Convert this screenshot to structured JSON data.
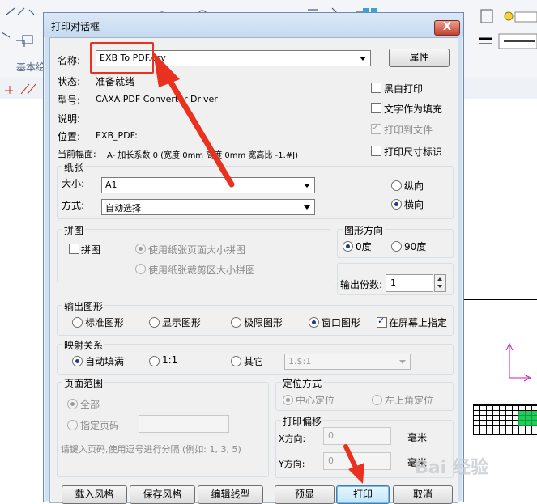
{
  "background_app": {
    "group_label": "基本绘"
  },
  "dialog": {
    "title": "打印对话框",
    "close_label": "X",
    "name_label": "名称:",
    "name_value": "EXB To PDF.drv",
    "properties_button": "属性",
    "status_label": "状态:",
    "status_value": "准备就绪",
    "model_label": "型号:",
    "model_value": "CAXA PDF Converter Driver",
    "desc_label": "说明:",
    "location_label": "位置:",
    "location_value": "EXB_PDF:",
    "current_size_label": "当前幅面:",
    "current_size_value": "A-  加长系数 0    (宽度 0mm    高度 0mm    宽高比 -1.#J)",
    "checkboxes": {
      "bw": {
        "label": "黑白打印",
        "checked": false
      },
      "text_fill": {
        "label": "文字作为填充",
        "checked": false
      },
      "to_file": {
        "label": "打印到文件",
        "checked": true
      },
      "size_mark": {
        "label": "打印尺寸标识",
        "checked": false
      }
    },
    "paper": {
      "title": "纸张",
      "size_label": "大小:",
      "size_value": "A1",
      "mode_label": "方式:",
      "mode_value": "自动选择",
      "portrait": "纵向",
      "landscape": "横向"
    },
    "tile": {
      "title": "拼图",
      "tile_check": "拼图",
      "opt1": "使用纸张页面大小拼图",
      "opt2": "使用纸张裁剪区大小拼图"
    },
    "orientation": {
      "title": "图形方向",
      "deg0": "0度",
      "deg90": "90度"
    },
    "copies_label": "输出份数:",
    "copies_value": "1",
    "output": {
      "title": "输出图形",
      "standard": "标准图形",
      "display": "显示图形",
      "limits": "极限图形",
      "window": "窗口图形",
      "on_screen": "在屏幕上指定"
    },
    "mapping": {
      "title": "映射关系",
      "fill": "自动填满",
      "one_to_one": "1:1",
      "other": "其它",
      "ratio_value": "1.$:1"
    },
    "page_range": {
      "title": "页面范围",
      "all": "全部",
      "pages": "指定页码",
      "hint": "请键入页码,使用逗号进行分隔  (例如: 1, 3, 5)"
    },
    "position": {
      "title": "定位方式",
      "center": "中心定位",
      "top_left": "左上角定位"
    },
    "offset": {
      "title": "打印偏移",
      "x_label": "X方向:",
      "x_value": "0",
      "y_label": "Y方向:",
      "y_value": "0",
      "unit": "毫米"
    },
    "buttons": {
      "load_style": "载入风格",
      "save_style": "保存风格",
      "edit_linetype": "编辑线型",
      "preview": "预显",
      "print": "打印",
      "cancel": "取消"
    }
  },
  "watermark": "Bai  经验",
  "colors": {
    "annotation_red": "#e8321f",
    "dialog_frame": "#cfe0f3"
  }
}
